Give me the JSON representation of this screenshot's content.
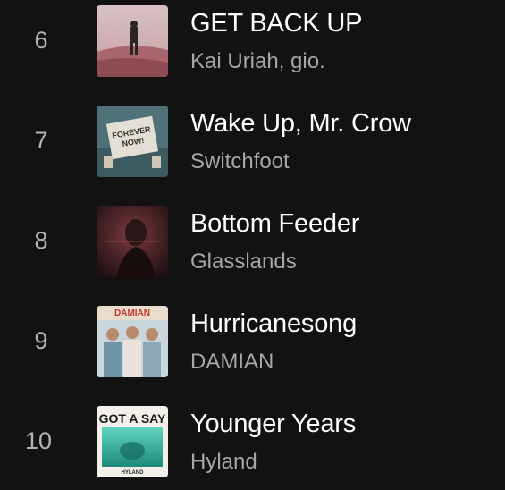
{
  "tracks": [
    {
      "rank": "6",
      "title": "GET BACK UP",
      "artist": "Kai Uriah, gio.",
      "cover_colors": [
        "#c9a2a8",
        "#9e6c73"
      ]
    },
    {
      "rank": "7",
      "title": "Wake Up, Mr. Crow",
      "artist": "Switchfoot",
      "cover_colors": [
        "#d9d4c9",
        "#4a6e77"
      ],
      "cover_text": "FOREVER NOW!"
    },
    {
      "rank": "8",
      "title": "Bottom Feeder",
      "artist": "Glasslands",
      "cover_colors": [
        "#5a2a2e",
        "#2a1416"
      ]
    },
    {
      "rank": "9",
      "title": "Hurricanesong",
      "artist": "DAMIAN",
      "cover_colors": [
        "#e8dccd",
        "#c0392b"
      ],
      "cover_text": "DAMIAN"
    },
    {
      "rank": "10",
      "title": "Younger Years",
      "artist": "Hyland",
      "cover_colors": [
        "#f4f1ea",
        "#2fb9a3"
      ],
      "cover_text": "GOT A SAY",
      "cover_subtext": "HYLAND"
    }
  ]
}
